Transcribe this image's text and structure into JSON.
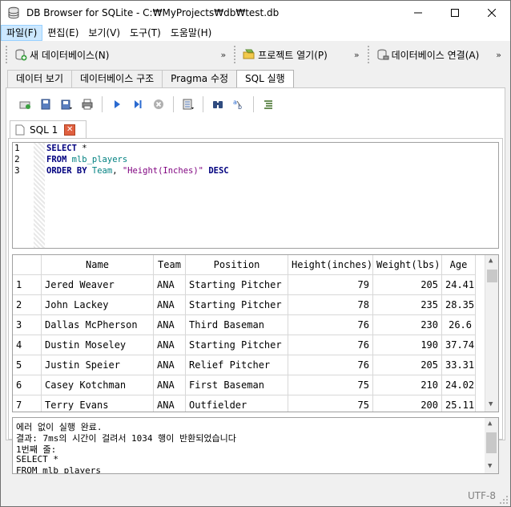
{
  "window": {
    "title": "DB Browser for SQLite - C:₩MyProjects₩db₩test.db",
    "controls": {
      "minimize": "—",
      "maximize": "☐",
      "close": "✕"
    }
  },
  "menu": [
    "파일(F)",
    "편집(E)",
    "보기(V)",
    "도구(T)",
    "도움말(H)"
  ],
  "main_toolbar": {
    "new_db": "새 데이터베이스(N)",
    "open_project": "프로젝트 열기(P)",
    "connect_db": "데이터베이스 연결(A)",
    "overflow": "»"
  },
  "tabs": [
    "데이터 보기",
    "데이터베이스 구조",
    "Pragma 수정",
    "SQL 실행"
  ],
  "active_tab": "SQL 실행",
  "sql_tab": {
    "label": "SQL 1",
    "close": "✕"
  },
  "editor": {
    "line_numbers": [
      "1",
      "2",
      "3"
    ],
    "lines": [
      {
        "kw": "SELECT",
        "rest": " *"
      },
      {
        "kw": "FROM",
        "rest": " mlb_players"
      },
      {
        "kw": "ORDER BY",
        "id": " Team",
        "sep": ", ",
        "str": "\"Height(Inches)\"",
        "kw2": " DESC"
      }
    ]
  },
  "results": {
    "columns": [
      "Name",
      "Team",
      "Position",
      "Height(inches)",
      "Weight(lbs)",
      "Age"
    ],
    "rows": [
      {
        "n": "1",
        "name": "Jered Weaver",
        "team": "ANA",
        "pos": "Starting Pitcher",
        "h": "79",
        "w": "205",
        "age": "24.41"
      },
      {
        "n": "2",
        "name": "John Lackey",
        "team": "ANA",
        "pos": "Starting Pitcher",
        "h": "78",
        "w": "235",
        "age": "28.35"
      },
      {
        "n": "3",
        "name": "Dallas McPherson",
        "team": "ANA",
        "pos": "Third Baseman",
        "h": "76",
        "w": "230",
        "age": "26.6"
      },
      {
        "n": "4",
        "name": "Dustin Moseley",
        "team": "ANA",
        "pos": "Starting Pitcher",
        "h": "76",
        "w": "190",
        "age": "37.74"
      },
      {
        "n": "5",
        "name": "Justin Speier",
        "team": "ANA",
        "pos": "Relief Pitcher",
        "h": "76",
        "w": "205",
        "age": "33.31"
      },
      {
        "n": "6",
        "name": "Casey Kotchman",
        "team": "ANA",
        "pos": "First Baseman",
        "h": "75",
        "w": "210",
        "age": "24.02"
      },
      {
        "n": "7",
        "name": "Terry Evans",
        "team": "ANA",
        "pos": "Outfielder",
        "h": "75",
        "w": "200",
        "age": "25.11"
      }
    ]
  },
  "messages": [
    "에러 없이 실행 완료.",
    "결과: 7ms의 시간이 걸려서 1034 행이 반환되었습니다",
    "1번째 줄:",
    "SELECT *",
    "FROM mlb_players"
  ],
  "status": {
    "encoding": "UTF-8"
  }
}
